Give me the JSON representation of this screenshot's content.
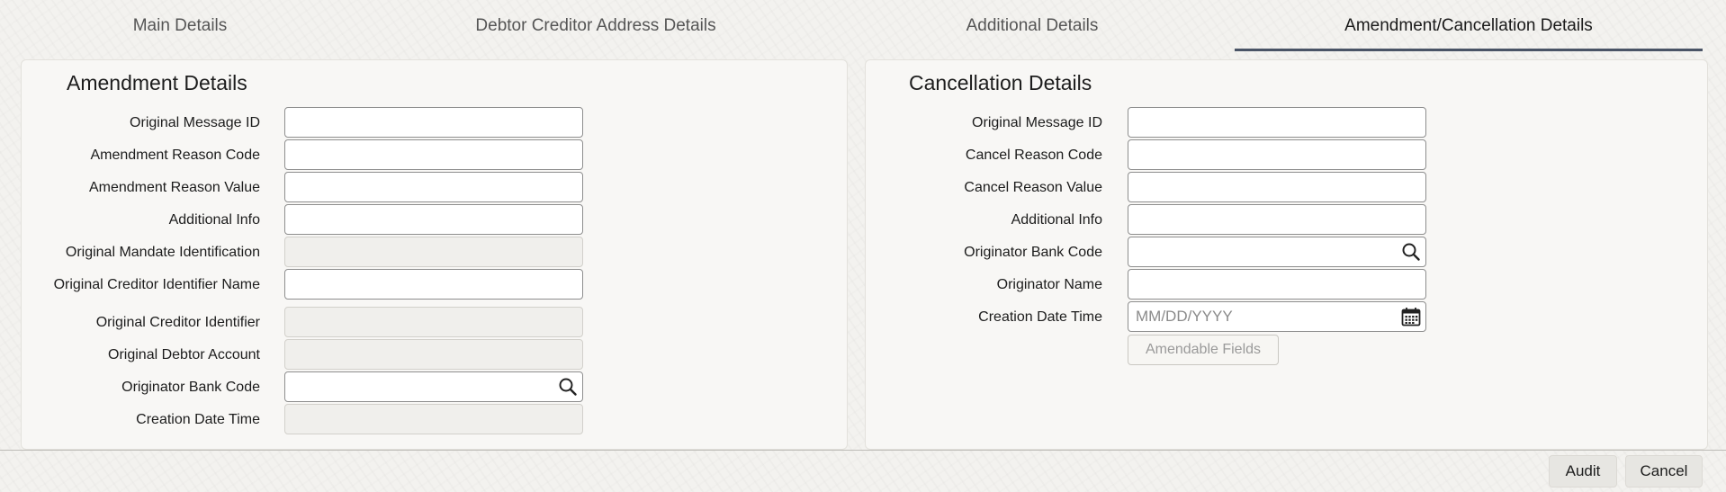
{
  "tabs": [
    {
      "label": "Main Details"
    },
    {
      "label": "Debtor Creditor Address Details"
    },
    {
      "label": "Additional Details"
    },
    {
      "label": "Amendment/Cancellation Details"
    }
  ],
  "active_tab": "Amendment/Cancellation Details",
  "amendment": {
    "title": "Amendment Details",
    "fields": {
      "original_message_id": {
        "label": "Original Message ID",
        "value": ""
      },
      "amendment_reason_code": {
        "label": "Amendment Reason Code",
        "value": ""
      },
      "amendment_reason_value": {
        "label": "Amendment Reason Value",
        "value": ""
      },
      "additional_info": {
        "label": "Additional Info",
        "value": ""
      },
      "original_mandate_identification": {
        "label": "Original Mandate Identification",
        "value": ""
      },
      "original_creditor_identifier_name": {
        "label": "Original Creditor Identifier Name",
        "value": ""
      },
      "original_creditor_identifier": {
        "label": "Original Creditor Identifier",
        "value": ""
      },
      "original_debtor_account": {
        "label": "Original Debtor Account",
        "value": ""
      },
      "originator_bank_code": {
        "label": "Originator Bank Code",
        "value": ""
      },
      "creation_date_time": {
        "label": "Creation Date Time",
        "value": ""
      }
    }
  },
  "cancellation": {
    "title": "Cancellation Details",
    "fields": {
      "original_message_id": {
        "label": "Original Message ID",
        "value": ""
      },
      "cancel_reason_code": {
        "label": "Cancel Reason Code",
        "value": ""
      },
      "cancel_reason_value": {
        "label": "Cancel Reason Value",
        "value": ""
      },
      "additional_info": {
        "label": "Additional Info",
        "value": ""
      },
      "originator_bank_code": {
        "label": "Originator Bank Code",
        "value": ""
      },
      "originator_name": {
        "label": "Originator Name",
        "value": ""
      },
      "creation_date_time": {
        "label": "Creation Date Time",
        "value": "",
        "placeholder": "MM/DD/YYYY"
      }
    },
    "amendable_fields_label": "Amendable Fields"
  },
  "footer": {
    "audit_label": "Audit",
    "cancel_label": "Cancel"
  },
  "icons": {
    "search": "search-icon",
    "calendar": "calendar-icon"
  },
  "colors": {
    "active_tab_underline": "#4a5466",
    "field_border": "#8e8e8e",
    "disabled_field_bg": "#f0efec"
  }
}
